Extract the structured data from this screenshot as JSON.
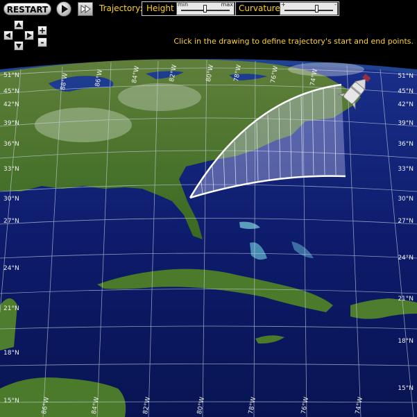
{
  "toolbar": {
    "restart_label": "RESTART",
    "play_icon": "play-icon",
    "step_icon": "step-forward-icon",
    "trajectory_label": "Trajectory:",
    "height_label": "Height",
    "height_min": "min",
    "height_max": "max",
    "height_level": 0.48,
    "curvature_label": "Curvature",
    "curvature_min": "+",
    "curvature_max": "-",
    "curvature_level": 0.66
  },
  "map": {
    "instruction": "Click in the drawing to define trajectory's start and end points.",
    "lat_labels_left": [
      "51°N",
      "45°N",
      "42°N",
      "39°N",
      "36°N",
      "33°N",
      "30°N",
      "27°N",
      "24°N",
      "21°N",
      "18°N",
      "15°N"
    ],
    "lat_labels_right": [
      "51°N",
      "45°N",
      "42°N",
      "39°N",
      "36°N",
      "33°N",
      "30°N",
      "27°N",
      "24°N",
      "21°N",
      "18°N",
      "15°N"
    ],
    "lon_labels_top": [
      "88°W",
      "86°W",
      "84°W",
      "82°W",
      "80°W",
      "78°W",
      "76°W",
      "74°W"
    ],
    "lon_labels_bottom": [
      "86°W",
      "84°W",
      "82°W",
      "80°W",
      "78°W",
      "76°W",
      "74°W"
    ],
    "colors": {
      "ocean": "#0d1b6b",
      "land": "#3f6b22",
      "toolbar_text": "#ffd21e",
      "trajectory": "#ffffff"
    }
  },
  "nav": {
    "up_icon": "arrow-up-icon",
    "down_icon": "arrow-down-icon",
    "left_icon": "arrow-left-icon",
    "right_icon": "arrow-right-icon",
    "zoom_in_label": "+",
    "zoom_out_label": "-"
  }
}
